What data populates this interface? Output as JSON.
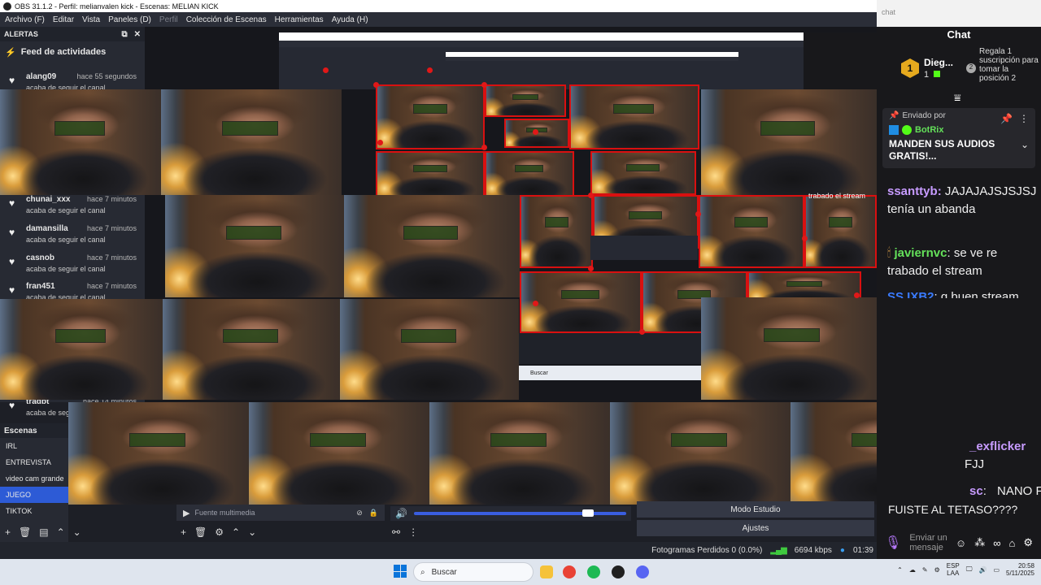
{
  "window": {
    "title": "OBS 31.1.2 - Perfil: melianvalen kick - Escenas: MELIAN KICK"
  },
  "menubar": {
    "items": [
      "Archivo (F)",
      "Editar",
      "Vista",
      "Paneles (D)",
      "Perfil",
      "Colección de Escenas",
      "Herramientas",
      "Ayuda (H)"
    ]
  },
  "alerts_dock": {
    "header": "ALERTAS",
    "feed_title": "Feed de actividades",
    "items": [
      {
        "user": "alang09",
        "time": "hace 55 segundos",
        "action": "acaba de seguir el canal"
      },
      {
        "user": "chunai_xxx",
        "time": "hace 7 minutos",
        "action": "acaba de seguir el canal"
      },
      {
        "user": "damansilla",
        "time": "hace 7 minutos",
        "action": "acaba de seguir el canal"
      },
      {
        "user": "casnob",
        "time": "hace 7 minutos",
        "action": "acaba de seguir el canal"
      },
      {
        "user": "fran451",
        "time": "hace 7 minutos",
        "action": "acaba de seguir el canal"
      },
      {
        "user": "tradbt",
        "time": "hace 14 minutos",
        "action": "acaba de seg"
      }
    ]
  },
  "scenes_dock": {
    "header": "Escenas",
    "scenes": [
      "IRL",
      "ENTREVISTA",
      "video cam grande",
      "JUEGO",
      "TIKTOK"
    ],
    "active_scene": "JUEGO"
  },
  "sources": {
    "media_label": "Fuente multimedia"
  },
  "controls": {
    "studio_mode": "Modo Estudio",
    "settings": "Ajustes"
  },
  "status_bar": {
    "dropped_frames": "Fotogramas Perdidos 0 (0.0%)",
    "bitrate": "6694 kbps",
    "time": "01:39"
  },
  "chat": {
    "url_placeholder": "chat",
    "title": "Chat",
    "top_gifter": {
      "name": "Dieg...",
      "rank": "1",
      "count": "1"
    },
    "gift_prompt": "Regala 1 suscripción para tomar la posición 2",
    "pinned": {
      "label": "Enviado por",
      "user": "BotRix",
      "message": "MANDEN SUS AUDIOS GRATIS!..."
    },
    "messages": [
      {
        "user": "ssanttyb",
        "text": "JAJAJAJSJSJSJ tenía un abanda"
      },
      {
        "user": "javiernvc",
        "text": "se ve re trabado el stream"
      },
      {
        "user": "SS IXB2",
        "text": "q buen stream"
      }
    ],
    "partial_messages": [
      {
        "user": "_exflicker",
        "text": "FJJ"
      },
      {
        "user": "sc",
        "text": "NANO FUISTE AL TETASO????"
      }
    ],
    "input_placeholder": "Enviar un mensaje"
  },
  "overlay_text": {
    "stuck_stream": "trabado el stream",
    "search": "Buscar"
  },
  "taskbar": {
    "search_placeholder": "Buscar",
    "lang": "ESP",
    "lang2": "LAA",
    "clock_time": "20:58",
    "clock_date": "5/11/2025"
  },
  "colors": {
    "accent_blue": "#2d5bd6",
    "scene_red_outline": "#d91010",
    "chat_purple": "#c79bff",
    "chat_green": "#64e05a",
    "kick_green": "#53fc18"
  }
}
